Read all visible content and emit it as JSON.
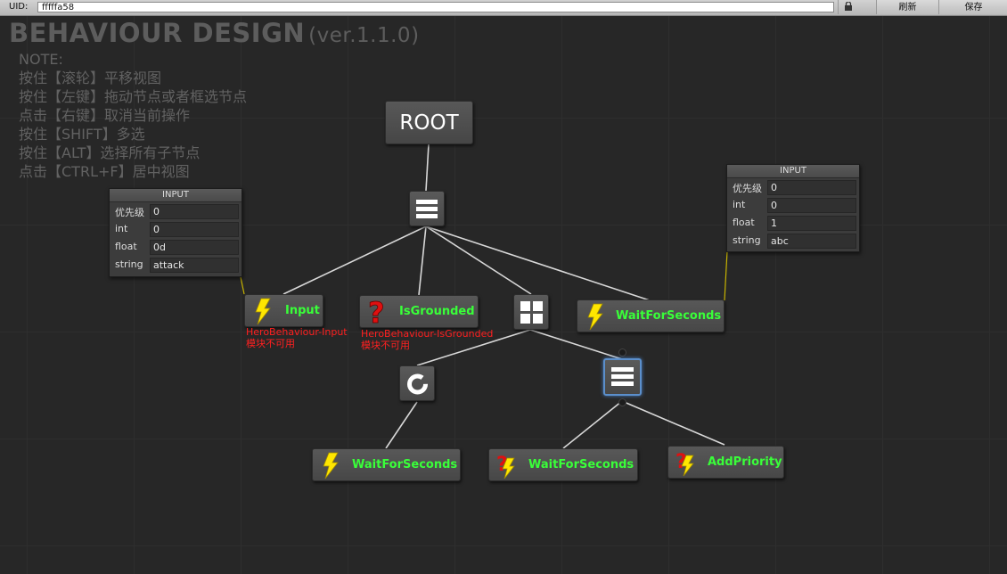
{
  "toolbar": {
    "uid_label": "UID:",
    "uid_value": "fffffa58",
    "refresh": "刷新",
    "save": "保存"
  },
  "header": {
    "title": "BEHAVIOUR DESIGN",
    "version": "(ver.1.1.0)"
  },
  "notes": [
    "NOTE:",
    "按住【滚轮】平移视图",
    "按住【左键】拖动节点或者框选节点",
    "点击【右键】取消当前操作",
    "按住【SHIFT】多选",
    "按住【ALT】选择所有子节点",
    "点击【CTRL+F】居中视图"
  ],
  "nodes": {
    "root": "ROOT",
    "input": {
      "label": "Input",
      "error1": "HeroBehaviour-Input",
      "error2": "模块不可用",
      "icon": "lightning-icon"
    },
    "isgrounded": {
      "label": "IsGrounded",
      "error1": "HeroBehaviour-IsGrounded",
      "error2": "模块不可用",
      "icon": "question-icon"
    },
    "wait_top": {
      "label": "WaitForSeconds",
      "icon": "lightning-icon"
    },
    "wait_left": {
      "label": "WaitForSeconds",
      "icon": "lightning-icon"
    },
    "wait_mid": {
      "label": "WaitForSeconds",
      "icon": "question-lightning-icon"
    },
    "addpriority": {
      "label": "AddPriority",
      "icon": "question-lightning-icon"
    }
  },
  "input_left": {
    "title": "INPUT",
    "rows": [
      {
        "key": "优先级",
        "value": "0"
      },
      {
        "key": "int",
        "value": "0"
      },
      {
        "key": "float",
        "value": "0d"
      },
      {
        "key": "string",
        "value": "attack"
      }
    ]
  },
  "input_right": {
    "title": "INPUT",
    "rows": [
      {
        "key": "优先级",
        "value": "0"
      },
      {
        "key": "int",
        "value": "0"
      },
      {
        "key": "float",
        "value": "1"
      },
      {
        "key": "string",
        "value": "abc"
      }
    ]
  },
  "colors": {
    "action_label": "#39ff39",
    "error": "#ff2020",
    "selected": "#5b8fcc",
    "data_link": "#c8b400"
  }
}
